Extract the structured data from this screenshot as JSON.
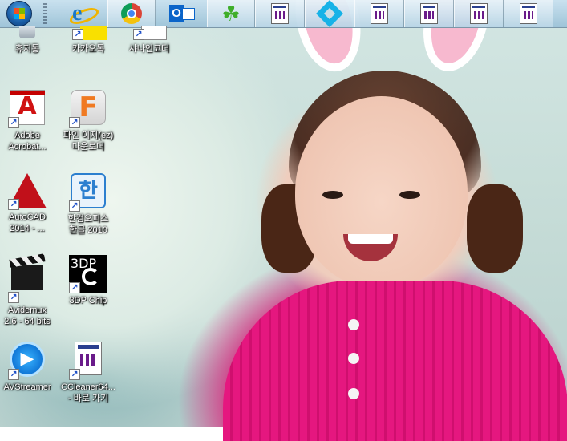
{
  "taskbar": {
    "items": [
      {
        "name": "start-button",
        "icon": "windows-orb-icon"
      },
      {
        "name": "internet-explorer",
        "icon": "ie-icon"
      },
      {
        "name": "google-chrome",
        "icon": "chrome-icon"
      },
      {
        "name": "outlook",
        "icon": "outlook-icon"
      },
      {
        "name": "clover",
        "icon": "clover-icon"
      },
      {
        "name": "kodi",
        "icon": "kodi-icon"
      },
      {
        "name": "document-window",
        "icon": "document-icon"
      }
    ]
  },
  "desktop": {
    "icons": [
      {
        "label": "휴지통"
      },
      {
        "label": "카카오톡"
      },
      {
        "label": "샤나인코더"
      },
      {
        "label": "Adobe\nAcrobat..."
      },
      {
        "label": "파인 이지(ez)\n다운로더"
      },
      {
        "label": "AutoCAD\n2014 - ..."
      },
      {
        "label": "한컴오피스\n한글 2010"
      },
      {
        "label": "Avidemux\n2.6 - 64 bits"
      },
      {
        "label": "3DP Chip"
      },
      {
        "label": "AVStreamer"
      },
      {
        "label": "CCleaner64...\n- 바로 가기"
      }
    ],
    "icon_glyphs": {
      "acrobat": "A",
      "finekey": "F",
      "hwp": "한",
      "threedp": "3DP",
      "avstreamer": "▶",
      "shortcut": "↗"
    }
  },
  "colors": {
    "accent": "#e5177f",
    "taskbar": "#a9cbe0"
  }
}
